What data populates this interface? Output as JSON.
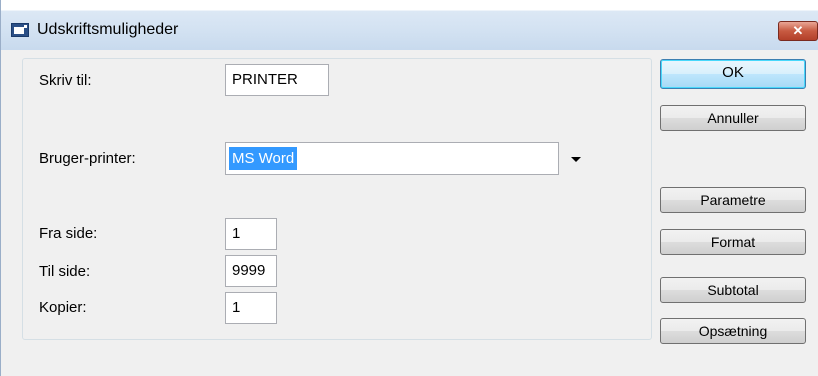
{
  "window": {
    "title": "Udskriftsmuligheder"
  },
  "form": {
    "write_to_label": "Skriv til:",
    "write_to_value": "PRINTER",
    "user_printer_label": "Bruger-printer:",
    "user_printer_value": "MS Word",
    "from_page_label": "Fra side:",
    "from_page_value": "1",
    "to_page_label": "Til side:",
    "to_page_value": "9999",
    "copies_label": "Kopier:",
    "copies_value": "1"
  },
  "buttons": {
    "ok": "OK",
    "cancel": "Annuller",
    "parameters": "Parametre",
    "format": "Format",
    "subtotal": "Subtotal",
    "setup": "Opsætning"
  },
  "icons": {
    "app": "printer-dialog-icon",
    "close": "close-icon",
    "dropdown": "chevron-down-icon"
  },
  "colors": {
    "selection": "#3399ff",
    "close_button": "#c75a41",
    "default_button_border": "#3c7fb1"
  }
}
